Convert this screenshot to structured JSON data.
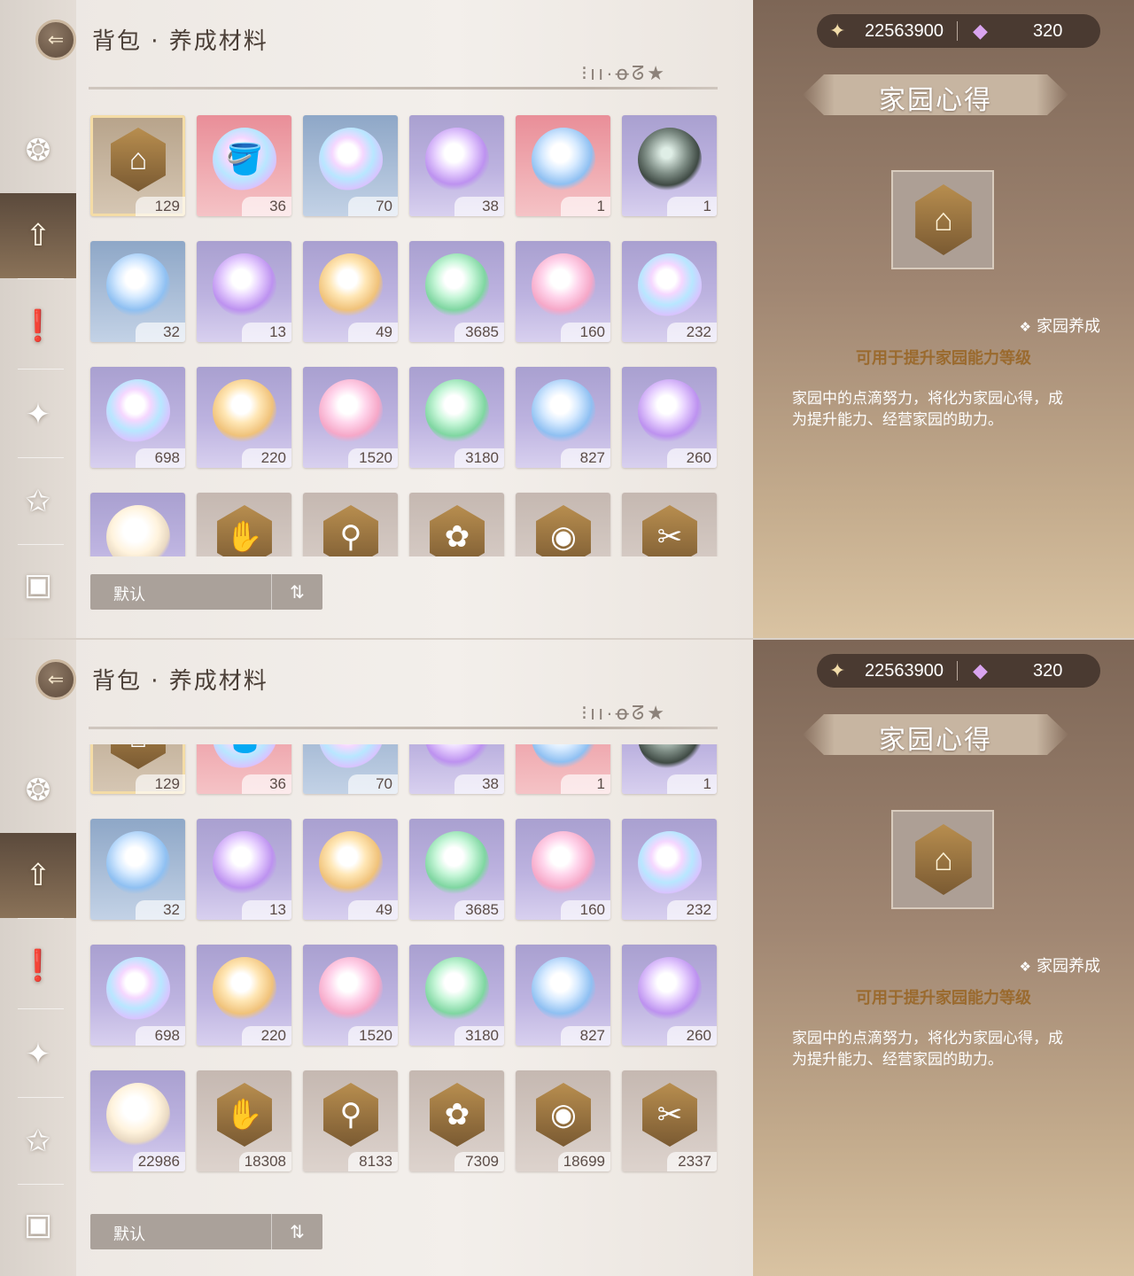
{
  "header": {
    "title": "背包 · 养成材料",
    "deco": "⁝ıı·ꝋᘔ★"
  },
  "currency": {
    "gold": "22563900",
    "gem": "320"
  },
  "sort": {
    "label": "默认",
    "toggle": "⇅"
  },
  "nav": [
    {
      "id": "fish",
      "icon": "fish-icon",
      "glyph": "❂"
    },
    {
      "id": "upgrade",
      "icon": "up-arrow-icon",
      "glyph": "⇧",
      "active": true
    },
    {
      "id": "quest",
      "icon": "exclamation-icon",
      "glyph": "❗"
    },
    {
      "id": "crystal",
      "icon": "crystal-icon",
      "glyph": "✦"
    },
    {
      "id": "star",
      "icon": "star-wand-icon",
      "glyph": "✩"
    },
    {
      "id": "box",
      "icon": "box-icon",
      "glyph": "▣"
    }
  ],
  "detail": {
    "name": "家园心得",
    "tag": "家园养成",
    "subtitle": "可用于提升家园能力等级",
    "description": "家园中的点滴努力，将化为家园心得，成为提升能力、经营家园的助力。"
  },
  "items": [
    {
      "qty": "129",
      "bg": "gold",
      "icon": "home-hex",
      "selected": true
    },
    {
      "qty": "36",
      "bg": "pink",
      "icon": "rainbow-bucket"
    },
    {
      "qty": "70",
      "bg": "blue",
      "icon": "orb-rainbow"
    },
    {
      "qty": "38",
      "bg": "purple",
      "icon": "orb-violet"
    },
    {
      "qty": "1",
      "bg": "pink",
      "icon": "orb-blue"
    },
    {
      "qty": "1",
      "bg": "purple",
      "icon": "orb-dark"
    },
    {
      "qty": "32",
      "bg": "blue",
      "icon": "orb-blue"
    },
    {
      "qty": "13",
      "bg": "purple",
      "icon": "orb-violet"
    },
    {
      "qty": "49",
      "bg": "purple",
      "icon": "orb-gold"
    },
    {
      "qty": "3685",
      "bg": "purple",
      "icon": "orb-green"
    },
    {
      "qty": "160",
      "bg": "purple",
      "icon": "orb-pink"
    },
    {
      "qty": "232",
      "bg": "purple",
      "icon": "orb-rainbow"
    },
    {
      "qty": "698",
      "bg": "purple",
      "icon": "orb-rainbow"
    },
    {
      "qty": "220",
      "bg": "purple",
      "icon": "orb-gold"
    },
    {
      "qty": "1520",
      "bg": "purple",
      "icon": "orb-pink"
    },
    {
      "qty": "3180",
      "bg": "purple",
      "icon": "orb-green"
    },
    {
      "qty": "827",
      "bg": "purple",
      "icon": "orb-blue"
    },
    {
      "qty": "260",
      "bg": "purple",
      "icon": "orb-violet"
    },
    {
      "qty": "22986",
      "bg": "purple",
      "icon": "orb-pearl"
    },
    {
      "qty": "18308",
      "bg": "gray",
      "icon": "hand-hex"
    },
    {
      "qty": "8133",
      "bg": "gray",
      "icon": "magnifier-hex"
    },
    {
      "qty": "7309",
      "bg": "gray",
      "icon": "fish-hex"
    },
    {
      "qty": "18699",
      "bg": "gray",
      "icon": "bucket-hex"
    },
    {
      "qty": "2337",
      "bg": "gray",
      "icon": "tools-hex"
    }
  ],
  "colors": {
    "accent": "#9a6a2e",
    "panel": "#7d6656",
    "sortBar": "#aaa19a"
  }
}
